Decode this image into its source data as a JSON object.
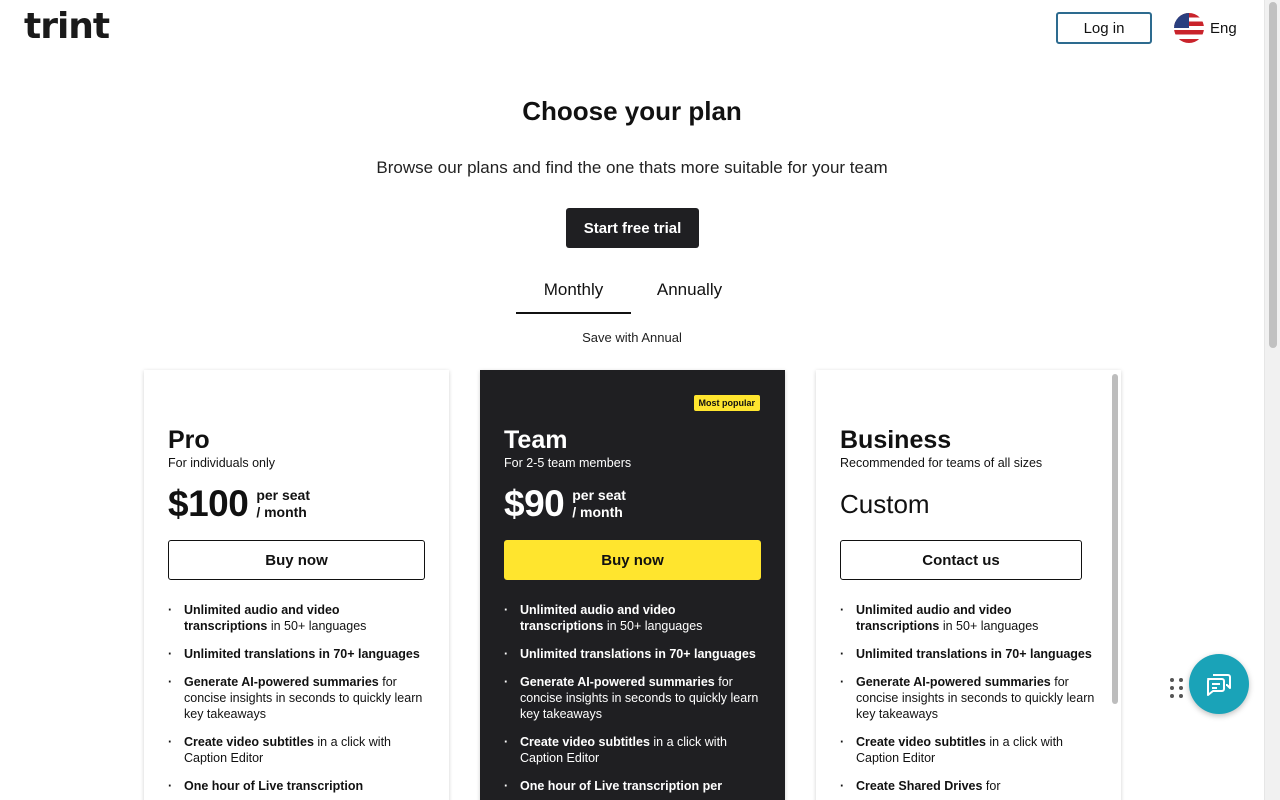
{
  "header": {
    "logo": "trint",
    "login_label": "Log in",
    "language_label": "Eng",
    "language_icon": "us-flag-icon"
  },
  "hero": {
    "title": "Choose your plan",
    "subtitle": "Browse our plans and find the one thats more suitable for your team",
    "trial_label": "Start free trial"
  },
  "billing": {
    "tabs": [
      {
        "label": "Monthly",
        "selected": true
      },
      {
        "label": "Annually",
        "selected": false
      }
    ],
    "save_note": "Save with Annual"
  },
  "plans": [
    {
      "name": "Pro",
      "description": "For individuals only",
      "price": "$100",
      "per_line1": "per seat",
      "per_line2": "/ month",
      "button": "Buy now",
      "features": [
        {
          "bold": "Unlimited audio and video transcriptions",
          "rest": " in 50+ languages"
        },
        {
          "bold": "Unlimited translations in 70+ languages",
          "rest": ""
        },
        {
          "bold": "Generate AI-powered summaries",
          "rest": " for concise insights in seconds to quickly learn key takeaways"
        },
        {
          "bold": "Create video subtitles",
          "rest": " in a click with Caption Editor"
        },
        {
          "bold": "One hour of Live transcription",
          "rest": ""
        }
      ]
    },
    {
      "name": "Team",
      "badge": "Most popular",
      "description": "For 2-5 team members",
      "price": "$90",
      "per_line1": "per seat",
      "per_line2": "/ month",
      "button": "Buy now",
      "features": [
        {
          "bold": "Unlimited audio and video transcriptions",
          "rest": " in 50+ languages"
        },
        {
          "bold": "Unlimited translations in 70+ languages",
          "rest": ""
        },
        {
          "bold": "Generate AI-powered summaries",
          "rest": " for concise insights in seconds to quickly learn key takeaways"
        },
        {
          "bold": "Create video subtitles",
          "rest": " in a click with Caption Editor"
        },
        {
          "bold": "One hour of Live transcription per",
          "rest": ""
        }
      ]
    },
    {
      "name": "Business",
      "description": "Recommended for teams of all sizes",
      "price": "Custom",
      "button": "Contact us",
      "features": [
        {
          "bold": "Unlimited audio and video transcriptions",
          "rest": " in 50+ languages"
        },
        {
          "bold": "Unlimited translations in 70+ languages",
          "rest": ""
        },
        {
          "bold": "Generate AI-powered summaries",
          "rest": " for concise insights in seconds to quickly learn key takeaways"
        },
        {
          "bold": "Create video subtitles",
          "rest": " in a click with Caption Editor"
        },
        {
          "bold": "Create Shared Drives",
          "rest": " for"
        }
      ]
    }
  ],
  "widgets": {
    "chat_icon": "chat-bubbles-icon",
    "drag_icon": "drag-handle-icon",
    "accent_color": "#1aa3b8",
    "highlight_color": "#ffe52e"
  }
}
